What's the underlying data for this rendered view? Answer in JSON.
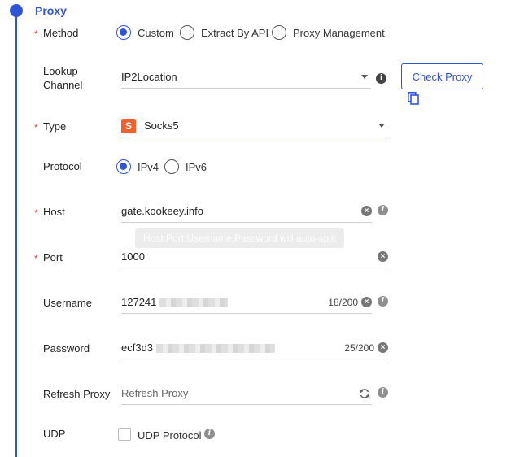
{
  "section": {
    "title": "Proxy"
  },
  "method": {
    "label": "Method",
    "options": [
      "Custom",
      "Extract By API",
      "Proxy Management"
    ],
    "selected": "Custom"
  },
  "lookup": {
    "label_line1": "Lookup",
    "label_line2": "Channel",
    "value": "IP2Location",
    "check_button": "Check Proxy"
  },
  "type": {
    "label": "Type",
    "badge": "S",
    "value": "Socks5"
  },
  "protocol": {
    "label": "Protocol",
    "options": [
      "IPv4",
      "IPv6"
    ],
    "selected": "IPv4"
  },
  "host": {
    "label": "Host",
    "value": "gate.kookeey.info",
    "tooltip": "Host:Port:Username:Password will auto-split"
  },
  "port": {
    "label": "Port",
    "value": "1000"
  },
  "username": {
    "label": "Username",
    "value_visible": "127241",
    "count": "18/200"
  },
  "password": {
    "label": "Password",
    "value_visible": "ecf3d3",
    "count": "25/200"
  },
  "refresh": {
    "label": "Refresh Proxy",
    "placeholder": "Refresh Proxy"
  },
  "udp": {
    "label": "UDP",
    "checkbox_label": "UDP Protocol",
    "checked": false
  },
  "colors": {
    "accent": "#2f55d4",
    "required": "#e8443a",
    "socks_badge": "#f0612d"
  }
}
